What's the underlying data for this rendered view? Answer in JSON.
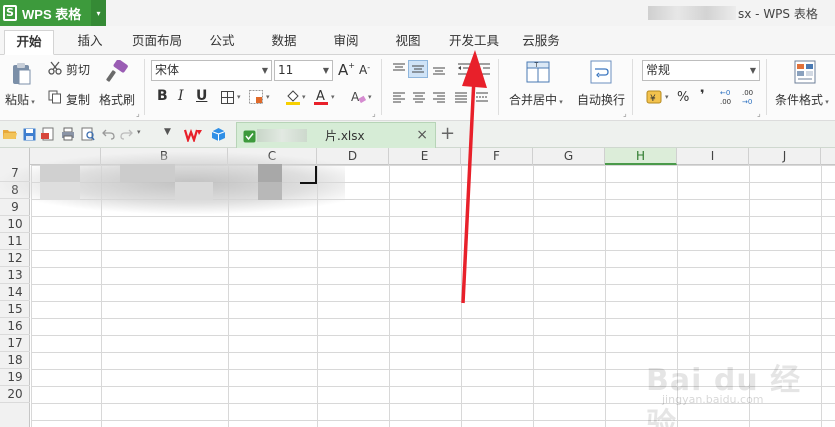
{
  "app": {
    "logo": "S",
    "name": "WPS 表格",
    "menu_arrow": "▾",
    "window_title": "sx - WPS 表格"
  },
  "tabs": [
    "开始",
    "插入",
    "页面布局",
    "公式",
    "数据",
    "审阅",
    "视图",
    "开发工具",
    "云服务"
  ],
  "ribbon": {
    "paste": "粘贴",
    "cut": "剪切",
    "copy": "复制",
    "format_painter": "格式刷",
    "font_name": "宋体",
    "font_size": "11",
    "bold": "B",
    "italic": "I",
    "underline": "U",
    "merge_center": "合并居中",
    "wrap_text": "自动换行",
    "number_format": "常规",
    "percent": "%",
    "comma": "❜",
    "conditional_format": "条件格式"
  },
  "document_tab": {
    "filename_suffix": "片.xlsx",
    "close": "×",
    "new": "+"
  },
  "columns": [
    "B",
    "C",
    "D",
    "E",
    "F",
    "G",
    "H",
    "I",
    "J"
  ],
  "rows": [
    "7",
    "8",
    "9",
    "10",
    "11",
    "12",
    "13",
    "14",
    "15",
    "16",
    "17",
    "18",
    "19",
    "20"
  ],
  "selected_column": "H",
  "colors": {
    "brand_green": "#3d9a3c",
    "arrow_red": "#e8202a",
    "selected_header": "#dcedd9"
  },
  "watermark": {
    "brand": "Bai du 经验",
    "url": "jingyan.baidu.com"
  }
}
